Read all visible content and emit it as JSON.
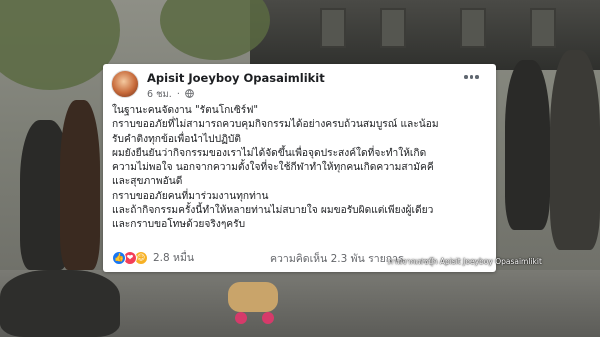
{
  "post": {
    "author": "Apisit Joeyboy Opasaimlikit",
    "time": "6 ชม.",
    "separator": "·",
    "privacy_icon": "globe-icon",
    "more_icon": "ellipsis-icon",
    "lines": [
      "ในฐานะคนจัดงาน \"รัตนโกเซิร์ฟ\"",
      "กราบขออภัยที่ไม่สามารถควบคุมกิจกรรมได้อย่างครบถ้วนสมบูรณ์ และน้อม",
      "รับคำติงทุกข้อเพื่อนำไปปฏิบัติ",
      "ผมยังยืนยันว่ากิจกรรมของเราไม่ได้จัดขึ้นเพื่อจุดประสงค์ใดที่จะทำให้เกิด",
      "ความไม่พอใจ นอกจากความตั้งใจที่จะใช้กีฬาทำให้ทุกคนเกิดความสามัคคี",
      "และสุขภาพอันดี",
      "กราบขออภัยคนที่มาร่วมงานทุกท่าน",
      "และถ้ากิจกรรมครั้งนี้ทำให้หลายท่านไม่สบายใจ ผมขอรับผิดแต่เพียงผู้เดียว",
      "และกราบขอโทษด้วยจริงๆครับ"
    ],
    "reactions": {
      "icons": [
        "like-icon",
        "love-icon",
        "care-icon"
      ],
      "count": "2.8 หมื่น"
    },
    "stats": "ความคิดเห็น 2.3 พัน รายการ",
    "colors": {
      "like": "#1877f2",
      "love": "#f33e58",
      "care": "#f7b125"
    }
  },
  "overlay": {
    "credit": "ภาพจากเฟซบุ๊ก Apisit Joeyboy Opasaimlikit"
  }
}
